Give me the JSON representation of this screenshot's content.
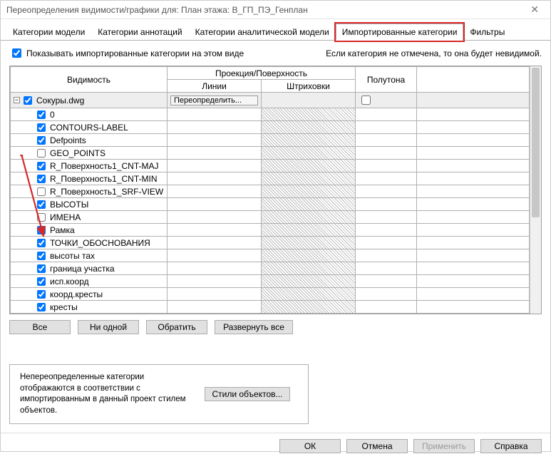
{
  "window": {
    "title": "Переопределения видимости/графики для: План этажа: B_ГП_ПЭ_Генплан"
  },
  "tabs": {
    "model": "Категории модели",
    "annot": "Категории аннотаций",
    "anal": "Категории аналитической модели",
    "import": "Импортированные категории",
    "filters": "Фильтры"
  },
  "top": {
    "show_imported": "Показывать импортированные категории на этом виде",
    "hint": "Если категория не отмечена, то она будет невидимой."
  },
  "headers": {
    "visibility": "Видимость",
    "proj": "Проекция/Поверхность",
    "lines": "Линии",
    "hatch": "Штриховки",
    "half": "Полутона"
  },
  "root": {
    "name": "Сокуры.dwg",
    "override_btn": "Переопределить..."
  },
  "rows": [
    {
      "name": "0",
      "checked": true
    },
    {
      "name": "CONTOURS-LABEL",
      "checked": true
    },
    {
      "name": "Defpoints",
      "checked": true
    },
    {
      "name": "GEO_POINTS",
      "checked": false
    },
    {
      "name": "R_Поверхность1_CNT-MAJ",
      "checked": true
    },
    {
      "name": "R_Поверхность1_CNT-MIN",
      "checked": true
    },
    {
      "name": "R_Поверхность1_SRF-VIEW",
      "checked": false
    },
    {
      "name": "ВЫСОТЫ",
      "checked": true
    },
    {
      "name": "ИМЕНА",
      "checked": false
    },
    {
      "name": "Рамка",
      "checked": true
    },
    {
      "name": "ТОЧКИ_ОБОСНОВАНИЯ",
      "checked": true
    },
    {
      "name": "высоты тах",
      "checked": true
    },
    {
      "name": "граница участка",
      "checked": true
    },
    {
      "name": "исп.коорд",
      "checked": true
    },
    {
      "name": "коорд.кресты",
      "checked": true
    },
    {
      "name": "кресты",
      "checked": true
    }
  ],
  "buttons": {
    "all": "Все",
    "none": "Ни одной",
    "invert": "Обратить",
    "expand": "Развернуть все",
    "obj_styles": "Стили объектов..."
  },
  "note": "Непереопределенные категории отображаются в соответствии с импортированным в данный проект стилем объектов.",
  "dlg": {
    "ok": "ОК",
    "cancel": "Отмена",
    "apply": "Применить",
    "help": "Справка"
  }
}
